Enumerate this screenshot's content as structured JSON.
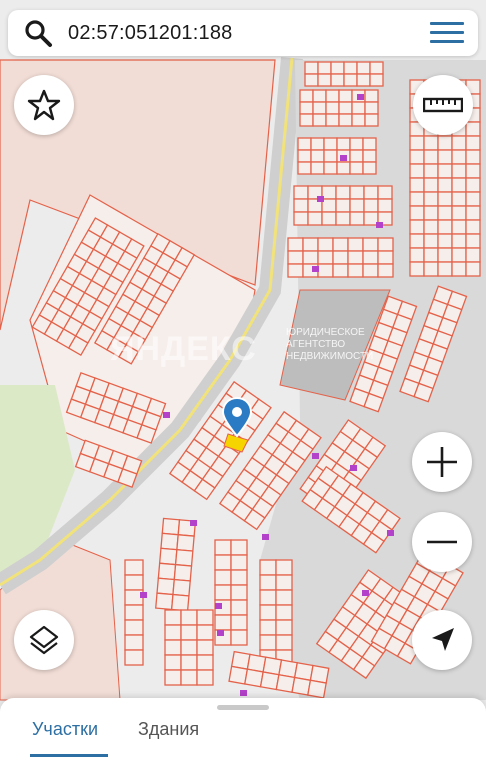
{
  "search": {
    "query": "02:57:051201:188",
    "search_icon": "search-icon",
    "menu_icon": "hamburger-menu-icon"
  },
  "controls": {
    "favorite_icon": "star-icon",
    "ruler_icon": "ruler-icon",
    "zoom_in_icon": "plus-icon",
    "zoom_out_icon": "minus-icon",
    "layers_icon": "layers-icon",
    "locate_icon": "navigation-arrow-icon"
  },
  "map": {
    "watermark_big": "ЯНДЕКС",
    "watermark_small": "ЮРИДИЧЕСКОЕ АГЕНТСТВО НЕДВИЖИМОСТИ",
    "marker_icon": "map-pin-icon",
    "colors": {
      "parcel_border": "#e4624a",
      "parcel_fill": "#f6eeea",
      "road": "#c9c9c9",
      "highway": "#f1e27a",
      "grass": "#dce9c7",
      "marker": "#2a7bc4",
      "selected": "#f5d400",
      "building": "#b341c9"
    }
  },
  "bottom_sheet": {
    "tabs": [
      {
        "label": "Участки",
        "active": true
      },
      {
        "label": "Здания",
        "active": false
      }
    ]
  }
}
